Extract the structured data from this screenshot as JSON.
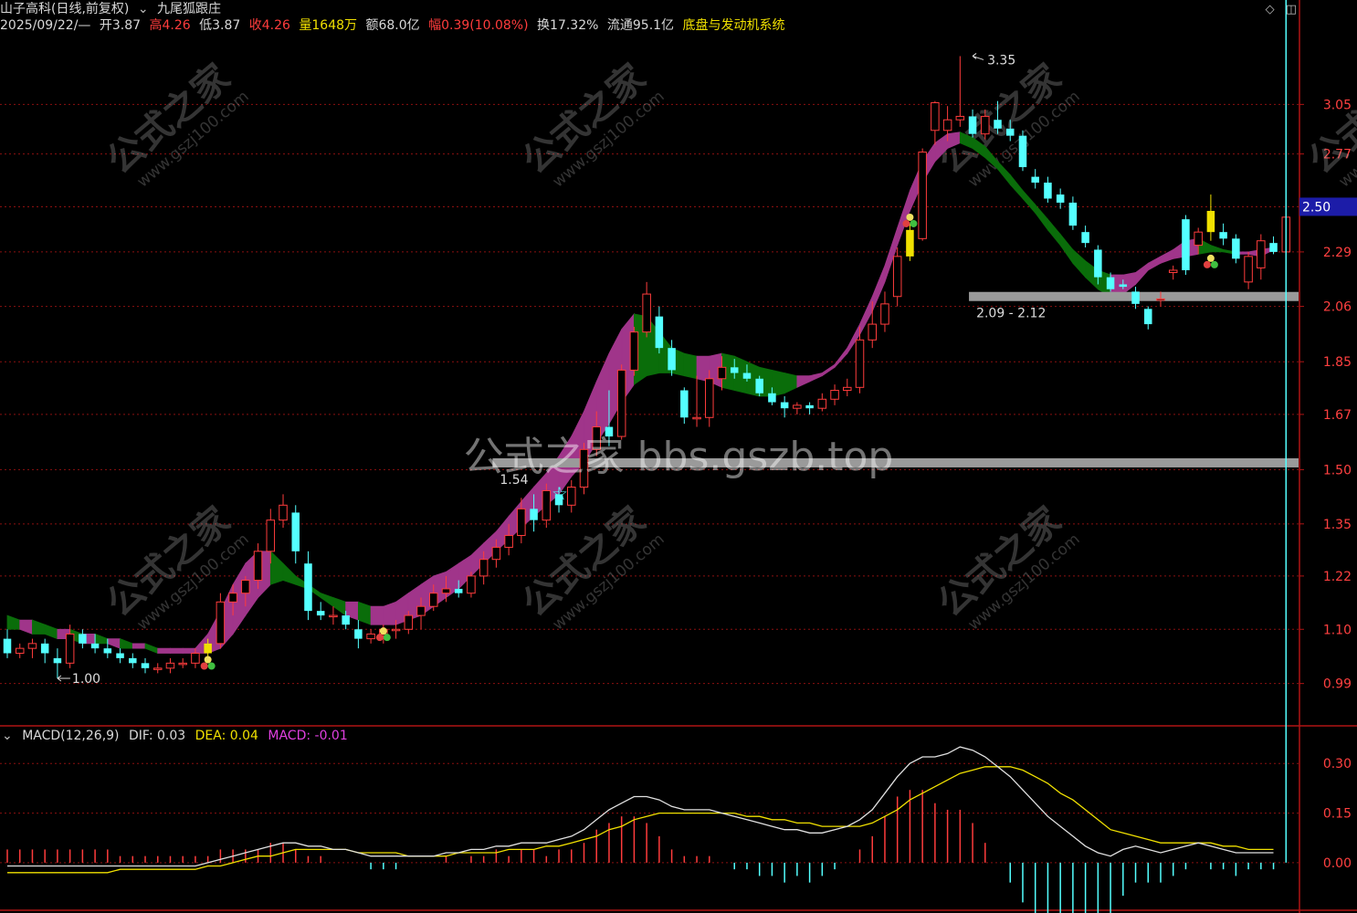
{
  "header": {
    "stock_name": "山子高科(日线,前复权)",
    "indicator_name": "九尾狐跟庄",
    "date": "2025/09/22/—",
    "open_label": "开",
    "open": "3.87",
    "high_label": "高",
    "high": "4.26",
    "low_label": "低",
    "low": "3.87",
    "close_label": "收",
    "close": "4.26",
    "volume_label": "量",
    "volume": "1648万",
    "amount_label": "额",
    "amount": "68.0亿",
    "change_label": "幅",
    "change": "0.39(10.08%)",
    "turnover_label": "换",
    "turnover": "17.32%",
    "float_label": "流通",
    "float_value": "95.1亿",
    "system_label": "底盘与发动机系统"
  },
  "toolbar_icons": [
    "diamond-icon",
    "window-icon"
  ],
  "watermarks": {
    "main": "公式之家 bbs.gszb.top",
    "logo_cn": "公式之家",
    "logo_url": "www.gszj100.com"
  },
  "colors": {
    "up": "#ff3c3c",
    "down": "#54ffff",
    "band_up": "#a0358a",
    "band_down": "#0a6d0a",
    "support": "#9a9a9a",
    "price_tag_bg": "#1c1ca8",
    "grid": "#8b1010",
    "dif": "#e0e0e0",
    "dea": "#f0e000"
  },
  "price_axis_labels": [
    "3.05",
    "2.77",
    "2.50",
    "2.29",
    "2.06",
    "1.85",
    "1.67",
    "1.50",
    "1.35",
    "1.22",
    "1.10",
    "0.99"
  ],
  "current_price_tag": "2.50",
  "annotations": {
    "high_mark": "3.35",
    "low_mark": "1.00",
    "support_low": "1.54",
    "support_high": "2.09 - 2.12"
  },
  "macd": {
    "label": "MACD(12,26,9)",
    "dif_label": "DIF: 0.03",
    "dea_label": "DEA: 0.04",
    "macd_label": "MACD: -0.01",
    "axis_labels": [
      "0.30",
      "0.15",
      "0.00"
    ]
  },
  "chart_data": {
    "type": "candlestick",
    "ylim": [
      0.92,
      3.48
    ],
    "candles": [
      {
        "o": 1.08,
        "h": 1.1,
        "l": 1.04,
        "c": 1.05
      },
      {
        "o": 1.05,
        "h": 1.07,
        "l": 1.04,
        "c": 1.06
      },
      {
        "o": 1.06,
        "h": 1.08,
        "l": 1.04,
        "c": 1.07
      },
      {
        "o": 1.07,
        "h": 1.08,
        "l": 1.03,
        "c": 1.05
      },
      {
        "o": 1.04,
        "h": 1.06,
        "l": 1.0,
        "c": 1.03
      },
      {
        "o": 1.03,
        "h": 1.11,
        "l": 1.02,
        "c": 1.09
      },
      {
        "o": 1.09,
        "h": 1.1,
        "l": 1.06,
        "c": 1.07
      },
      {
        "o": 1.07,
        "h": 1.09,
        "l": 1.05,
        "c": 1.06
      },
      {
        "o": 1.06,
        "h": 1.08,
        "l": 1.04,
        "c": 1.05
      },
      {
        "o": 1.05,
        "h": 1.06,
        "l": 1.03,
        "c": 1.04
      },
      {
        "o": 1.04,
        "h": 1.05,
        "l": 1.02,
        "c": 1.03
      },
      {
        "o": 1.03,
        "h": 1.04,
        "l": 1.01,
        "c": 1.02
      },
      {
        "o": 1.02,
        "h": 1.03,
        "l": 1.01,
        "c": 1.02
      },
      {
        "o": 1.02,
        "h": 1.04,
        "l": 1.01,
        "c": 1.03
      },
      {
        "o": 1.03,
        "h": 1.04,
        "l": 1.02,
        "c": 1.03
      },
      {
        "o": 1.03,
        "h": 1.06,
        "l": 1.02,
        "c": 1.05
      },
      {
        "o": 1.05,
        "h": 1.08,
        "l": 1.03,
        "c": 1.07
      },
      {
        "o": 1.07,
        "h": 1.18,
        "l": 1.06,
        "c": 1.16
      },
      {
        "o": 1.16,
        "h": 1.2,
        "l": 1.13,
        "c": 1.18
      },
      {
        "o": 1.18,
        "h": 1.22,
        "l": 1.15,
        "c": 1.21
      },
      {
        "o": 1.21,
        "h": 1.3,
        "l": 1.19,
        "c": 1.28
      },
      {
        "o": 1.28,
        "h": 1.39,
        "l": 1.25,
        "c": 1.36
      },
      {
        "o": 1.36,
        "h": 1.43,
        "l": 1.34,
        "c": 1.4
      },
      {
        "o": 1.38,
        "h": 1.4,
        "l": 1.25,
        "c": 1.28
      },
      {
        "o": 1.25,
        "h": 1.28,
        "l": 1.12,
        "c": 1.14
      },
      {
        "o": 1.14,
        "h": 1.16,
        "l": 1.12,
        "c": 1.13
      },
      {
        "o": 1.13,
        "h": 1.15,
        "l": 1.11,
        "c": 1.13
      },
      {
        "o": 1.13,
        "h": 1.14,
        "l": 1.1,
        "c": 1.11
      },
      {
        "o": 1.1,
        "h": 1.12,
        "l": 1.06,
        "c": 1.08
      },
      {
        "o": 1.08,
        "h": 1.1,
        "l": 1.07,
        "c": 1.09
      },
      {
        "o": 1.09,
        "h": 1.11,
        "l": 1.07,
        "c": 1.1
      },
      {
        "o": 1.1,
        "h": 1.12,
        "l": 1.08,
        "c": 1.1
      },
      {
        "o": 1.1,
        "h": 1.14,
        "l": 1.09,
        "c": 1.13
      },
      {
        "o": 1.13,
        "h": 1.17,
        "l": 1.1,
        "c": 1.15
      },
      {
        "o": 1.15,
        "h": 1.2,
        "l": 1.14,
        "c": 1.18
      },
      {
        "o": 1.18,
        "h": 1.22,
        "l": 1.16,
        "c": 1.19
      },
      {
        "o": 1.19,
        "h": 1.21,
        "l": 1.17,
        "c": 1.18
      },
      {
        "o": 1.18,
        "h": 1.23,
        "l": 1.17,
        "c": 1.22
      },
      {
        "o": 1.22,
        "h": 1.28,
        "l": 1.2,
        "c": 1.26
      },
      {
        "o": 1.26,
        "h": 1.31,
        "l": 1.24,
        "c": 1.29
      },
      {
        "o": 1.29,
        "h": 1.35,
        "l": 1.27,
        "c": 1.32
      },
      {
        "o": 1.32,
        "h": 1.42,
        "l": 1.3,
        "c": 1.39
      },
      {
        "o": 1.39,
        "h": 1.43,
        "l": 1.33,
        "c": 1.36
      },
      {
        "o": 1.36,
        "h": 1.46,
        "l": 1.34,
        "c": 1.44
      },
      {
        "o": 1.43,
        "h": 1.45,
        "l": 1.38,
        "c": 1.4
      },
      {
        "o": 1.4,
        "h": 1.47,
        "l": 1.38,
        "c": 1.45
      },
      {
        "o": 1.45,
        "h": 1.58,
        "l": 1.43,
        "c": 1.56
      },
      {
        "o": 1.56,
        "h": 1.68,
        "l": 1.54,
        "c": 1.63
      },
      {
        "o": 1.63,
        "h": 1.75,
        "l": 1.57,
        "c": 1.6
      },
      {
        "o": 1.6,
        "h": 1.84,
        "l": 1.59,
        "c": 1.82
      },
      {
        "o": 1.82,
        "h": 1.98,
        "l": 1.8,
        "c": 1.96
      },
      {
        "o": 1.96,
        "h": 2.16,
        "l": 1.94,
        "c": 2.11
      },
      {
        "o": 2.02,
        "h": 2.06,
        "l": 1.88,
        "c": 1.9
      },
      {
        "o": 1.9,
        "h": 1.93,
        "l": 1.8,
        "c": 1.82
      },
      {
        "o": 1.75,
        "h": 1.76,
        "l": 1.64,
        "c": 1.66
      },
      {
        "o": 1.66,
        "h": 1.8,
        "l": 1.63,
        "c": 1.66
      },
      {
        "o": 1.66,
        "h": 1.82,
        "l": 1.63,
        "c": 1.79
      },
      {
        "o": 1.79,
        "h": 1.87,
        "l": 1.75,
        "c": 1.83
      },
      {
        "o": 1.83,
        "h": 1.86,
        "l": 1.79,
        "c": 1.81
      },
      {
        "o": 1.81,
        "h": 1.84,
        "l": 1.78,
        "c": 1.79
      },
      {
        "o": 1.79,
        "h": 1.8,
        "l": 1.73,
        "c": 1.74
      },
      {
        "o": 1.74,
        "h": 1.76,
        "l": 1.7,
        "c": 1.71
      },
      {
        "o": 1.71,
        "h": 1.73,
        "l": 1.66,
        "c": 1.69
      },
      {
        "o": 1.69,
        "h": 1.71,
        "l": 1.67,
        "c": 1.7
      },
      {
        "o": 1.7,
        "h": 1.71,
        "l": 1.67,
        "c": 1.69
      },
      {
        "o": 1.69,
        "h": 1.74,
        "l": 1.68,
        "c": 1.72
      },
      {
        "o": 1.72,
        "h": 1.77,
        "l": 1.7,
        "c": 1.75
      },
      {
        "o": 1.75,
        "h": 1.79,
        "l": 1.73,
        "c": 1.76
      },
      {
        "o": 1.76,
        "h": 1.98,
        "l": 1.74,
        "c": 1.93
      },
      {
        "o": 1.93,
        "h": 2.08,
        "l": 1.9,
        "c": 1.99
      },
      {
        "o": 1.99,
        "h": 2.12,
        "l": 1.96,
        "c": 2.07
      },
      {
        "o": 2.1,
        "h": 2.31,
        "l": 2.06,
        "c": 2.27
      },
      {
        "o": 2.27,
        "h": 2.42,
        "l": 2.25,
        "c": 2.39
      },
      {
        "o": 2.35,
        "h": 2.8,
        "l": 2.34,
        "c": 2.78
      },
      {
        "o": 2.9,
        "h": 3.07,
        "l": 2.82,
        "c": 3.06
      },
      {
        "o": 2.9,
        "h": 3.04,
        "l": 2.84,
        "c": 2.96
      },
      {
        "o": 2.96,
        "h": 3.35,
        "l": 2.92,
        "c": 2.98
      },
      {
        "o": 2.98,
        "h": 3.02,
        "l": 2.86,
        "c": 2.88
      },
      {
        "o": 2.88,
        "h": 3.02,
        "l": 2.85,
        "c": 2.98
      },
      {
        "o": 2.96,
        "h": 3.07,
        "l": 2.88,
        "c": 2.91
      },
      {
        "o": 2.91,
        "h": 2.96,
        "l": 2.84,
        "c": 2.87
      },
      {
        "o": 2.87,
        "h": 2.9,
        "l": 2.68,
        "c": 2.7
      },
      {
        "o": 2.65,
        "h": 2.69,
        "l": 2.59,
        "c": 2.62
      },
      {
        "o": 2.62,
        "h": 2.65,
        "l": 2.52,
        "c": 2.54
      },
      {
        "o": 2.56,
        "h": 2.59,
        "l": 2.49,
        "c": 2.52
      },
      {
        "o": 2.52,
        "h": 2.55,
        "l": 2.39,
        "c": 2.41
      },
      {
        "o": 2.38,
        "h": 2.41,
        "l": 2.31,
        "c": 2.33
      },
      {
        "o": 2.3,
        "h": 2.32,
        "l": 2.15,
        "c": 2.18
      },
      {
        "o": 2.18,
        "h": 2.2,
        "l": 2.12,
        "c": 2.13
      },
      {
        "o": 2.15,
        "h": 2.17,
        "l": 2.13,
        "c": 2.14
      },
      {
        "o": 2.12,
        "h": 2.14,
        "l": 2.05,
        "c": 2.07
      },
      {
        "o": 2.05,
        "h": 2.06,
        "l": 1.97,
        "c": 1.99
      },
      {
        "o": 2.09,
        "h": 2.12,
        "l": 2.06,
        "c": 2.09
      },
      {
        "o": 2.2,
        "h": 2.23,
        "l": 2.17,
        "c": 2.21
      },
      {
        "o": 2.44,
        "h": 2.46,
        "l": 2.19,
        "c": 2.21
      },
      {
        "o": 2.32,
        "h": 2.4,
        "l": 2.28,
        "c": 2.38
      },
      {
        "o": 2.38,
        "h": 2.56,
        "l": 2.34,
        "c": 2.48
      },
      {
        "o": 2.38,
        "h": 2.42,
        "l": 2.32,
        "c": 2.35
      },
      {
        "o": 2.35,
        "h": 2.37,
        "l": 2.24,
        "c": 2.26
      },
      {
        "o": 2.16,
        "h": 2.29,
        "l": 2.13,
        "c": 2.27
      },
      {
        "o": 2.22,
        "h": 2.37,
        "l": 2.17,
        "c": 2.34
      },
      {
        "o": 2.33,
        "h": 2.36,
        "l": 2.28,
        "c": 2.29
      },
      {
        "o": 2.29,
        "h": 2.48,
        "l": 2.27,
        "c": 2.45
      }
    ],
    "band": {
      "upper": [
        1.13,
        1.12,
        1.12,
        1.11,
        1.1,
        1.1,
        1.09,
        1.09,
        1.08,
        1.08,
        1.07,
        1.07,
        1.06,
        1.06,
        1.06,
        1.06,
        1.09,
        1.14,
        1.2,
        1.25,
        1.28,
        1.28,
        1.25,
        1.22,
        1.2,
        1.18,
        1.17,
        1.16,
        1.16,
        1.15,
        1.15,
        1.16,
        1.18,
        1.2,
        1.22,
        1.23,
        1.25,
        1.27,
        1.3,
        1.33,
        1.37,
        1.41,
        1.45,
        1.49,
        1.54,
        1.6,
        1.68,
        1.78,
        1.88,
        1.97,
        2.03,
        2.02,
        1.96,
        1.9,
        1.88,
        1.87,
        1.87,
        1.88,
        1.87,
        1.85,
        1.83,
        1.82,
        1.81,
        1.8,
        1.8,
        1.81,
        1.84,
        1.9,
        1.99,
        2.1,
        2.23,
        2.4,
        2.58,
        2.73,
        2.83,
        2.88,
        2.89,
        2.86,
        2.81,
        2.73,
        2.66,
        2.58,
        2.51,
        2.44,
        2.37,
        2.3,
        2.25,
        2.21,
        2.19,
        2.19,
        2.2,
        2.24,
        2.27,
        2.3,
        2.34,
        2.35,
        2.32,
        2.3,
        2.29,
        2.29,
        2.3,
        2.31
      ],
      "lower": [
        1.1,
        1.1,
        1.09,
        1.09,
        1.08,
        1.08,
        1.07,
        1.07,
        1.07,
        1.06,
        1.06,
        1.06,
        1.05,
        1.05,
        1.05,
        1.05,
        1.05,
        1.06,
        1.09,
        1.13,
        1.17,
        1.2,
        1.21,
        1.2,
        1.19,
        1.17,
        1.15,
        1.13,
        1.12,
        1.11,
        1.11,
        1.11,
        1.12,
        1.13,
        1.15,
        1.17,
        1.19,
        1.22,
        1.25,
        1.28,
        1.31,
        1.34,
        1.37,
        1.4,
        1.43,
        1.48,
        1.52,
        1.58,
        1.64,
        1.71,
        1.77,
        1.8,
        1.81,
        1.81,
        1.8,
        1.79,
        1.78,
        1.76,
        1.75,
        1.74,
        1.73,
        1.73,
        1.74,
        1.76,
        1.78,
        1.8,
        1.83,
        1.88,
        1.95,
        2.04,
        2.16,
        2.32,
        2.48,
        2.62,
        2.73,
        2.8,
        2.83,
        2.8,
        2.75,
        2.69,
        2.61,
        2.54,
        2.47,
        2.39,
        2.32,
        2.24,
        2.18,
        2.13,
        2.1,
        2.11,
        2.15,
        2.21,
        2.24,
        2.26,
        2.27,
        2.28,
        2.29,
        2.29,
        2.28,
        2.28,
        2.27,
        2.3
      ]
    },
    "dif": [
      -0.01,
      -0.01,
      -0.01,
      -0.01,
      -0.01,
      -0.01,
      -0.01,
      -0.01,
      -0.01,
      -0.01,
      -0.01,
      -0.01,
      -0.01,
      -0.01,
      -0.01,
      -0.01,
      0.0,
      0.01,
      0.02,
      0.03,
      0.04,
      0.05,
      0.06,
      0.06,
      0.05,
      0.05,
      0.04,
      0.04,
      0.03,
      0.02,
      0.02,
      0.02,
      0.02,
      0.02,
      0.02,
      0.03,
      0.03,
      0.04,
      0.04,
      0.05,
      0.05,
      0.06,
      0.06,
      0.06,
      0.07,
      0.08,
      0.1,
      0.13,
      0.16,
      0.18,
      0.2,
      0.2,
      0.19,
      0.17,
      0.16,
      0.16,
      0.16,
      0.15,
      0.14,
      0.13,
      0.12,
      0.11,
      0.1,
      0.1,
      0.09,
      0.09,
      0.1,
      0.11,
      0.13,
      0.16,
      0.21,
      0.26,
      0.3,
      0.32,
      0.32,
      0.33,
      0.35,
      0.34,
      0.32,
      0.29,
      0.26,
      0.22,
      0.18,
      0.14,
      0.11,
      0.08,
      0.05,
      0.03,
      0.02,
      0.04,
      0.05,
      0.04,
      0.03,
      0.04,
      0.05,
      0.06,
      0.05,
      0.04,
      0.03,
      0.03,
      0.03,
      0.03
    ],
    "dea": [
      -0.03,
      -0.03,
      -0.03,
      -0.03,
      -0.03,
      -0.03,
      -0.03,
      -0.03,
      -0.03,
      -0.02,
      -0.02,
      -0.02,
      -0.02,
      -0.02,
      -0.02,
      -0.02,
      -0.01,
      -0.01,
      0.0,
      0.01,
      0.02,
      0.02,
      0.03,
      0.04,
      0.04,
      0.04,
      0.04,
      0.04,
      0.03,
      0.03,
      0.03,
      0.03,
      0.02,
      0.02,
      0.02,
      0.02,
      0.03,
      0.03,
      0.03,
      0.03,
      0.04,
      0.04,
      0.04,
      0.05,
      0.05,
      0.06,
      0.07,
      0.08,
      0.1,
      0.11,
      0.13,
      0.14,
      0.15,
      0.15,
      0.15,
      0.15,
      0.15,
      0.15,
      0.15,
      0.14,
      0.14,
      0.13,
      0.13,
      0.12,
      0.12,
      0.11,
      0.11,
      0.11,
      0.11,
      0.12,
      0.14,
      0.16,
      0.19,
      0.21,
      0.23,
      0.25,
      0.27,
      0.28,
      0.29,
      0.29,
      0.29,
      0.28,
      0.26,
      0.24,
      0.21,
      0.19,
      0.16,
      0.13,
      0.1,
      0.09,
      0.08,
      0.07,
      0.06,
      0.06,
      0.06,
      0.06,
      0.06,
      0.05,
      0.05,
      0.04,
      0.04,
      0.04
    ],
    "markers": {
      "yellow_candles": [
        16,
        72,
        96
      ],
      "ball_marks": [
        16,
        30,
        72,
        96
      ],
      "star_mark": 44
    },
    "support_lines": [
      {
        "value": 1.52,
        "from": 39,
        "label": "1.54"
      },
      {
        "value": 2.1,
        "from": 77,
        "label": "2.09 - 2.12"
      }
    ],
    "high_marker": {
      "index": 77,
      "value": 3.35,
      "label": "3.35"
    },
    "low_marker": {
      "index": 4,
      "value": 1.0,
      "label": "1.00"
    }
  }
}
